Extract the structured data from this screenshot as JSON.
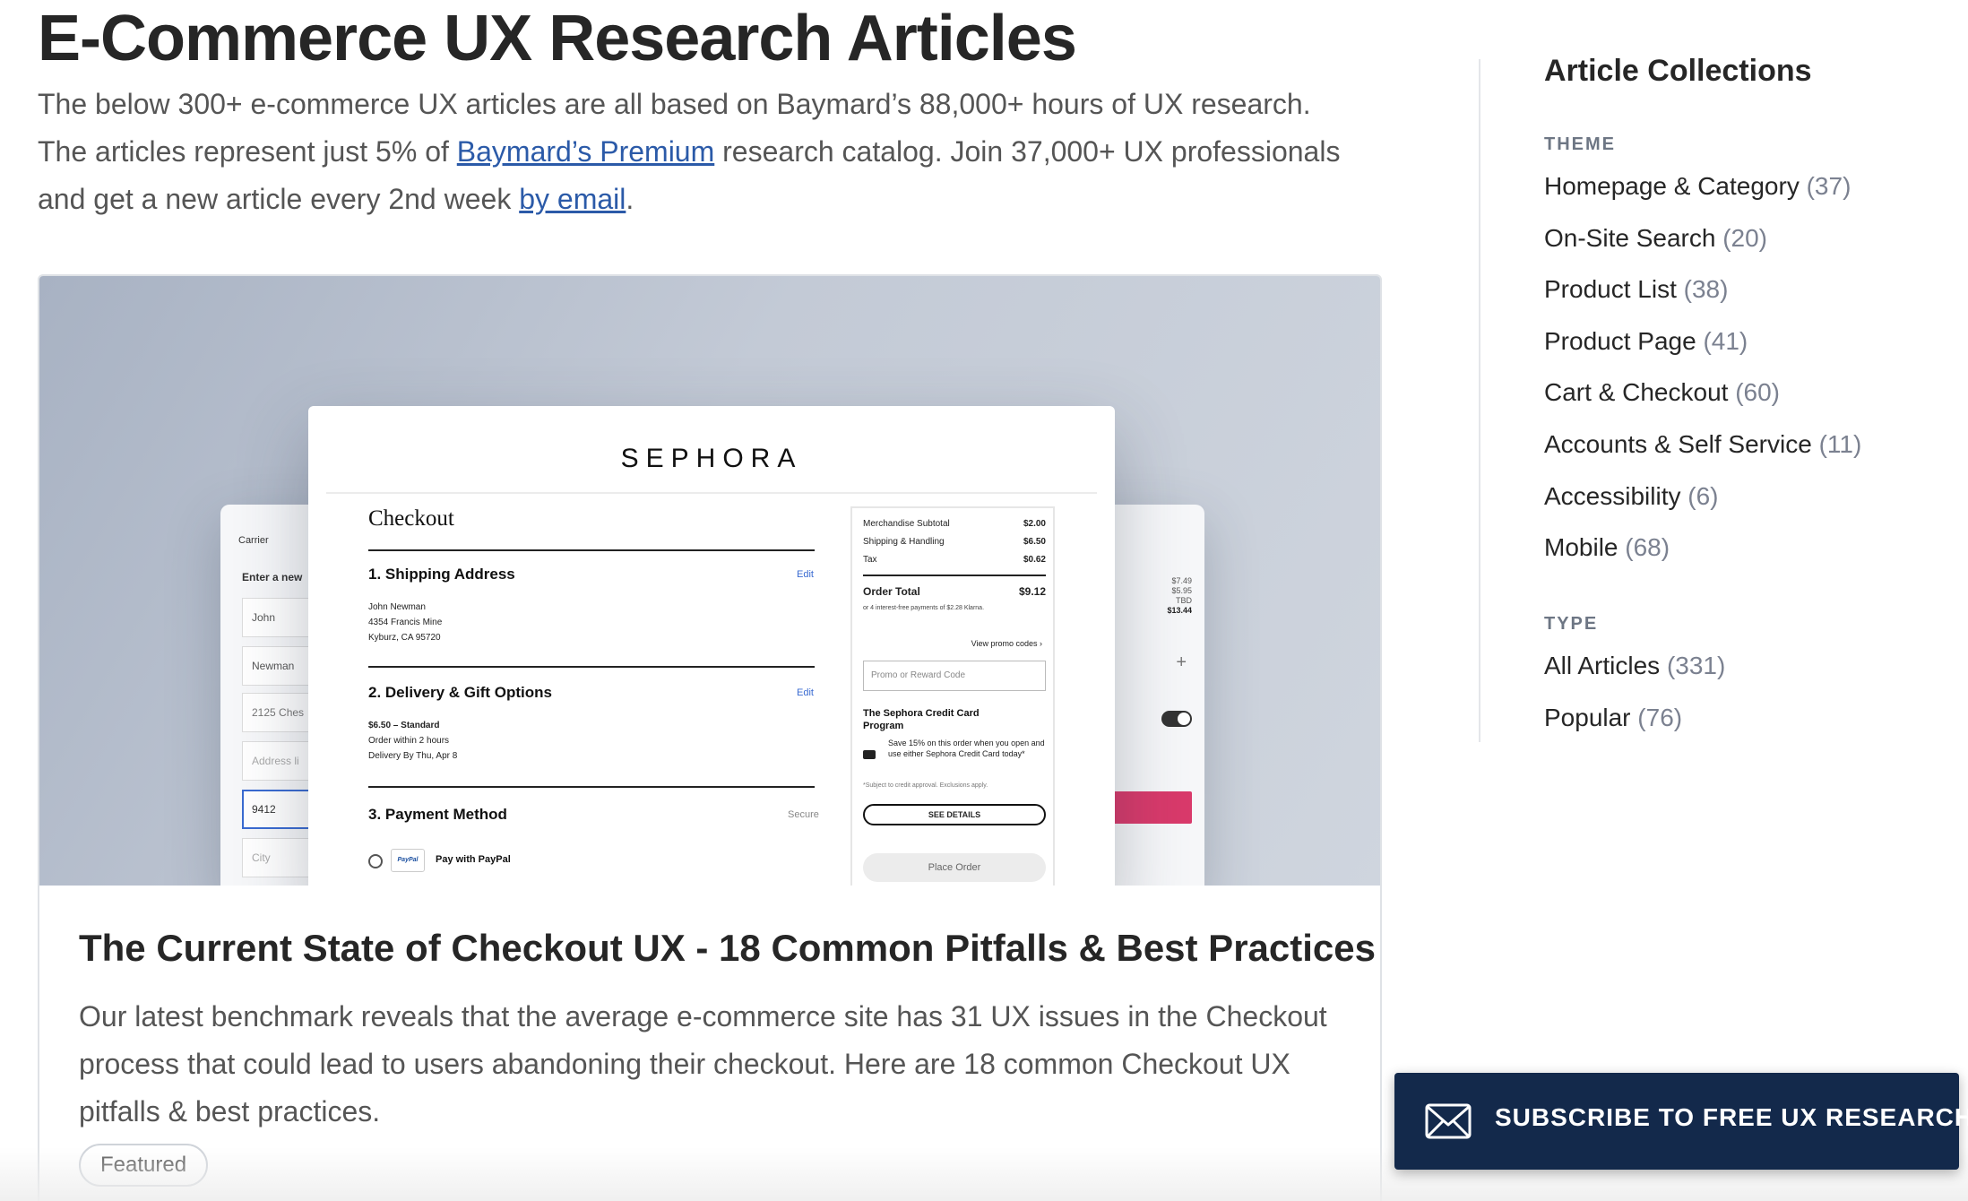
{
  "page": {
    "title": "E-Commerce UX Research Articles",
    "intro": {
      "line1": "The below 300+ e-commerce UX articles are all based on Baymard’s 88,000+ hours of UX research.",
      "line2_before": "The articles represent just 5% of ",
      "premium_link": "Baymard’s Premium",
      "line2_after": " research catalog. Join 37,000+ UX professionals",
      "line3_before": "and get a new article every 2nd week ",
      "email_link": "by email",
      "line3_after": "."
    }
  },
  "featured_card": {
    "title": "The Current State of Checkout UX - 18 Common Pitfalls & Best Practices",
    "description": "Our latest benchmark reveals that the average e-commerce site has 31 UX issues in the Checkout process that could lead to users abandoning their checkout. Here are 18 common Checkout UX pitfalls & best practices.",
    "badge": "Featured",
    "image": {
      "brand": "SEPHORA",
      "checkout_title": "Checkout",
      "sections": [
        {
          "title": "1. Shipping Address",
          "edit": "Edit",
          "lines": [
            "John Newman",
            "4354 Francis Mine",
            "Kyburz, CA 95720"
          ]
        },
        {
          "title": "2. Delivery & Gift Options",
          "edit": "Edit",
          "lines": [
            "$6.50 – Standard",
            "Order within 2 hours",
            "Delivery By Thu, Apr 8"
          ]
        },
        {
          "title": "3. Payment Method",
          "edit": "Secure",
          "lines": [
            "Pay with PayPal"
          ]
        }
      ],
      "summary": {
        "merch_label": "Merchandise Subtotal",
        "merch_value": "$2.00",
        "ship_label": "Shipping & Handling",
        "ship_value": "$6.50",
        "tax_label": "Tax",
        "tax_value": "$0.62",
        "total_label": "Order Total",
        "total_value": "$9.12",
        "klarna": "or 4 interest-free payments of $2.28 Klarna.",
        "view_promo": "View promo codes ›",
        "promo_placeholder": "Promo or Reward Code",
        "card_title": "The Sephora Credit Card Program",
        "card_text": "Save 15% on this order when you open and use either Sephora Credit Card today*",
        "card_note": "*Subject to credit approval. Exclusions apply.",
        "see_details": "SEE DETAILS",
        "place_order": "Place Order"
      },
      "phone_left": {
        "carrier": "Carrier",
        "prompt": "Enter a new",
        "fields": [
          "John",
          "Newman",
          "2125 Ches",
          "Address li",
          "9412",
          "City"
        ]
      },
      "phone_right": {
        "prices": [
          "$7.49",
          "$5.95",
          "TBD",
          "$13.44"
        ]
      }
    }
  },
  "sidebar": {
    "heading": "Article Collections",
    "theme_label": "THEME",
    "theme_items": [
      {
        "label": "Homepage & Category",
        "count": "(37)"
      },
      {
        "label": "On-Site Search",
        "count": "(20)"
      },
      {
        "label": "Product List",
        "count": "(38)"
      },
      {
        "label": "Product Page",
        "count": "(41)"
      },
      {
        "label": "Cart & Checkout",
        "count": "(60)"
      },
      {
        "label": "Accounts & Self Service",
        "count": "(11)"
      },
      {
        "label": "Accessibility",
        "count": "(6)"
      },
      {
        "label": "Mobile",
        "count": "(68)"
      }
    ],
    "type_label": "TYPE",
    "type_items": [
      {
        "label": "All Articles",
        "count": "(331)"
      },
      {
        "label": "Popular",
        "count": "(76)"
      }
    ]
  },
  "subscribe": {
    "label": "SUBSCRIBE TO FREE UX RESEARCH",
    "icon": "mail-icon"
  },
  "colors": {
    "link": "#2b5aa8",
    "subscribe_bg": "#13294b",
    "group_label": "#6d7684"
  }
}
